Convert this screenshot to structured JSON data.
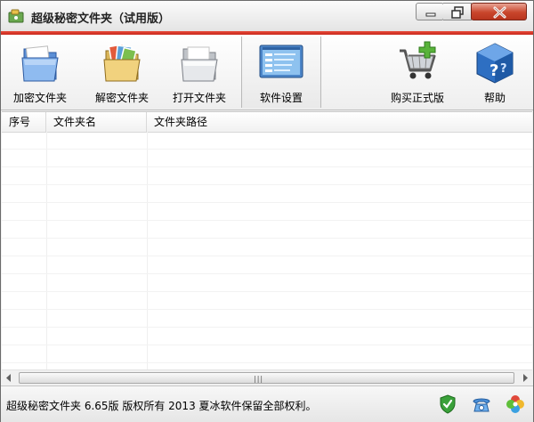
{
  "window": {
    "title": "超级秘密文件夹（试用版）",
    "accent_color": "#d9342a"
  },
  "toolbar": {
    "items": [
      {
        "label": "加密文件夹",
        "icon": "blue-folder-icon"
      },
      {
        "label": "解密文件夹",
        "icon": "photo-folder-icon"
      },
      {
        "label": "打开文件夹",
        "icon": "open-folder-icon"
      },
      {
        "label": "软件设置",
        "icon": "settings-window-icon",
        "active": true
      },
      {
        "label": "购买正式版",
        "icon": "shopping-cart-icon"
      },
      {
        "label": "帮助",
        "icon": "help-cube-icon"
      }
    ]
  },
  "table": {
    "columns": [
      "序号",
      "文件夹名",
      "文件夹路径"
    ],
    "rows": []
  },
  "status": {
    "text": "超级秘密文件夹 6.65版 版权所有 2013 夏冰软件保留全部权利。",
    "icons": [
      "shield-check-icon",
      "telephone-icon",
      "colorful-pinwheel-icon"
    ]
  }
}
